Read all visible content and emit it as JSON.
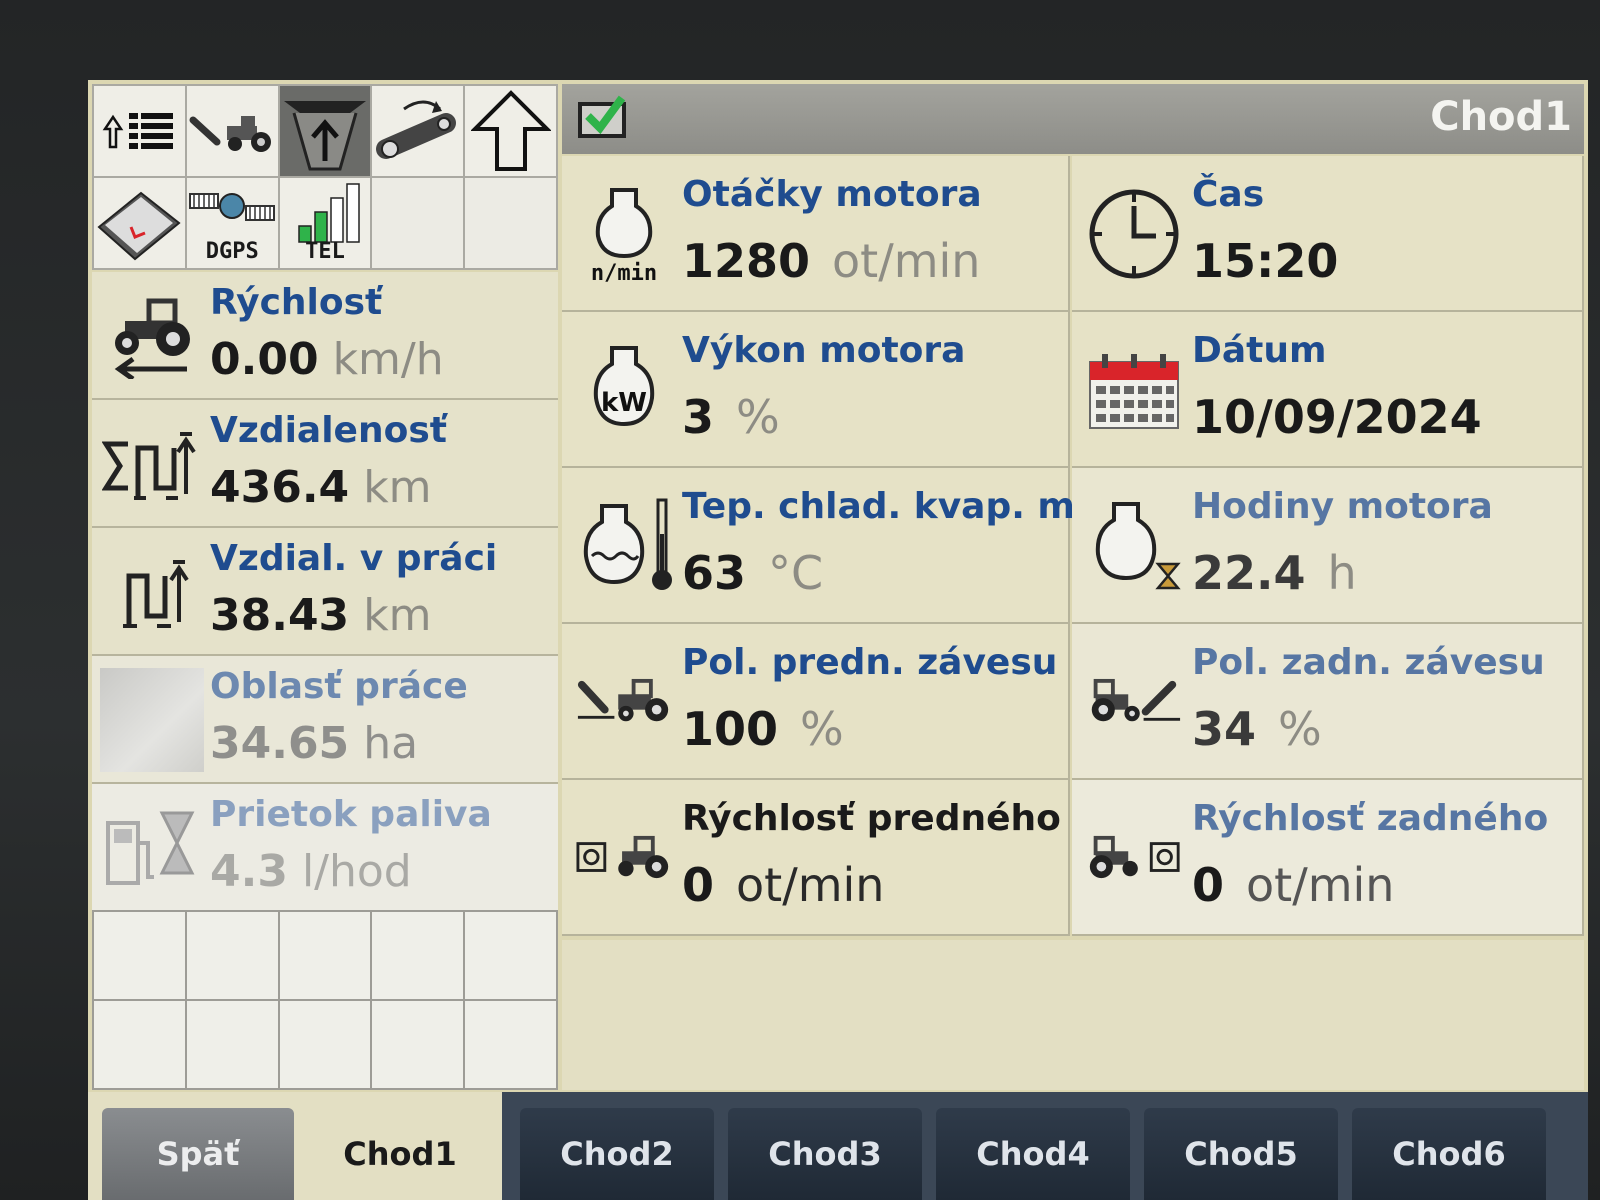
{
  "toolbar": {
    "tools": [
      {
        "name": "list-menu-icon",
        "label": ""
      },
      {
        "name": "front-hitch-tractor-icon",
        "label": ""
      },
      {
        "name": "hitch-up-icon",
        "label": ""
      },
      {
        "name": "rotate-link-icon",
        "label": ""
      },
      {
        "name": "arrow-up-icon",
        "label": ""
      },
      {
        "name": "book-icon",
        "label": ""
      },
      {
        "name": "dgps-satellite-icon",
        "label": "DGPS"
      },
      {
        "name": "tel-signal-icon",
        "label": "TEL"
      }
    ]
  },
  "left_list": [
    {
      "label": "Rýchlosť",
      "value": "0.00",
      "unit": "km/h",
      "icon": "tractor-speed-icon"
    },
    {
      "label": "Vzdialenosť",
      "value": "436.4",
      "unit": "km",
      "icon": "sum-distance-icon"
    },
    {
      "label": "Vzdial. v práci",
      "value": "38.43",
      "unit": "km",
      "icon": "work-distance-icon"
    },
    {
      "label": "Oblasť práce",
      "value": "34.65",
      "unit": "ha",
      "icon": "work-area-icon"
    },
    {
      "label": "Prietok paliva",
      "value": "4.3",
      "unit": "l/hod",
      "icon": "fuel-flow-icon"
    }
  ],
  "header": {
    "page_name": "Chod1"
  },
  "cells": [
    {
      "label": "Otáčky motora",
      "value": "1280",
      "unit": "ot/min",
      "icon": "engine-rpm-icon",
      "icon_text": "n/min"
    },
    {
      "label": "Čas",
      "value": "15:20",
      "unit": "",
      "icon": "clock-icon"
    },
    {
      "label": "Výkon motora",
      "value": "3",
      "unit": "%",
      "icon": "engine-power-icon",
      "icon_text": "kW"
    },
    {
      "label": "Dátum",
      "value": "10/09/2024",
      "unit": "",
      "icon": "calendar-icon"
    },
    {
      "label": "Tep. chlad. kvap. m",
      "value": "63",
      "unit": "°C",
      "icon": "coolant-temp-icon"
    },
    {
      "label": "Hodiny motora",
      "value": "22.4",
      "unit": "h",
      "icon": "engine-hours-icon"
    },
    {
      "label": "Pol. predn. závesu",
      "value": "100",
      "unit": "%",
      "icon": "front-hitch-position-icon"
    },
    {
      "label": "Pol. zadn. závesu",
      "value": "34",
      "unit": "%",
      "icon": "rear-hitch-position-icon"
    },
    {
      "label": "Rýchlosť predného",
      "value": "0",
      "unit": "ot/min",
      "icon": "front-pto-icon"
    },
    {
      "label": "Rýchlosť zadného",
      "value": "0",
      "unit": "ot/min",
      "icon": "rear-pto-icon"
    }
  ],
  "tabs": {
    "back": "Späť",
    "items": [
      "Chod1",
      "Chod2",
      "Chod3",
      "Chod4",
      "Chod5",
      "Chod6"
    ],
    "active": "Chod1"
  },
  "colors": {
    "label_blue": "#1f4c8f",
    "screen_bg": "#e6e2c6",
    "accent_green": "#2fb34a",
    "calendar_red": "#d9242a"
  }
}
